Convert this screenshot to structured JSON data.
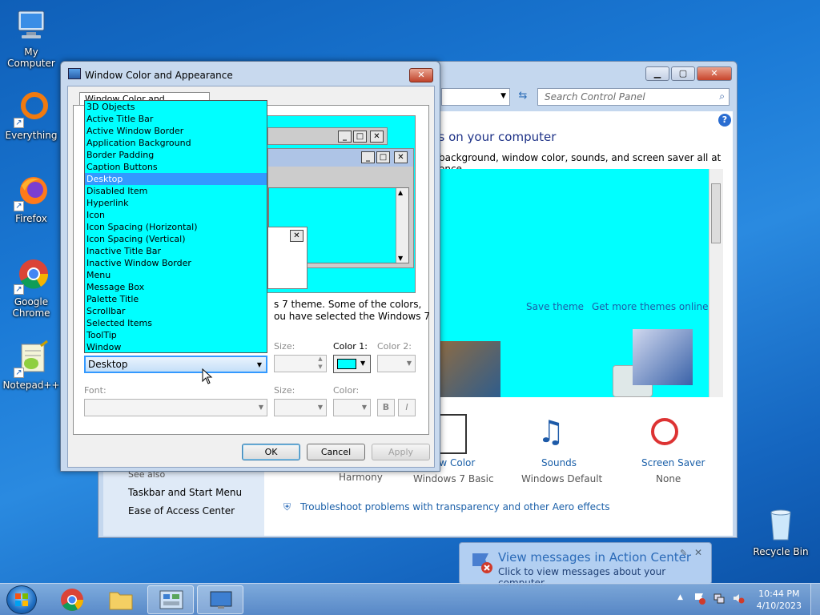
{
  "desktop": {
    "icons": [
      {
        "label": "My Computer"
      },
      {
        "label": "Everything"
      },
      {
        "label": "Firefox"
      },
      {
        "label": "Google Chrome"
      },
      {
        "label": "Notepad++"
      },
      {
        "label": "Recycle Bin"
      }
    ]
  },
  "control_panel": {
    "search_placeholder": "Search Control Panel",
    "heading": "ds on your computer",
    "subheading": "background, window color, sounds, and screen saver all at once.",
    "save_theme": "Save theme",
    "get_more_themes": "Get more themes online",
    "sidebar": {
      "see_also": "See also",
      "taskbar": "Taskbar and Start Menu",
      "ease": "Ease of Access Center"
    },
    "bottom": {
      "background_value": "Harmony",
      "window_color_label": "ow Color",
      "window_color_value": "Windows 7 Basic",
      "sounds_label": "Sounds",
      "sounds_value": "Windows Default",
      "saver_label": "Screen Saver",
      "saver_value": "None"
    },
    "troubleshoot": "Troubleshoot problems with transparency and other Aero effects"
  },
  "dialog": {
    "title": "Window Color and Appearance",
    "tab": "Window Color and Appearance",
    "desc_line1": "s 7 theme.  Some of the colors,",
    "desc_line2": "ou have selected the Windows 7",
    "item_size_label": "Size:",
    "color1_label": "Color 1:",
    "color2_label": "Color 2:",
    "font_label": "Font:",
    "font_size_label": "Size:",
    "font_color_label": "Color:",
    "bold": "B",
    "italic": "I",
    "ok": "OK",
    "cancel": "Cancel",
    "apply": "Apply",
    "selected_item": "Desktop",
    "items": [
      "3D Objects",
      "Active Title Bar",
      "Active Window Border",
      "Application Background",
      "Border Padding",
      "Caption Buttons",
      "Desktop",
      "Disabled Item",
      "Hyperlink",
      "Icon",
      "Icon Spacing (Horizontal)",
      "Icon Spacing (Vertical)",
      "Inactive Title Bar",
      "Inactive Window Border",
      "Menu",
      "Message Box",
      "Palette Title",
      "Scrollbar",
      "Selected Items",
      "ToolTip",
      "Window"
    ],
    "color1_value": "#00ffff"
  },
  "notification": {
    "title": "View messages in Action Center",
    "subtitle": "Click to view messages about your computer."
  },
  "taskbar": {
    "time": "10:44 PM",
    "date": "4/10/2023"
  },
  "colors": {
    "accent": "#3399ff",
    "preview": "#00ffff"
  }
}
